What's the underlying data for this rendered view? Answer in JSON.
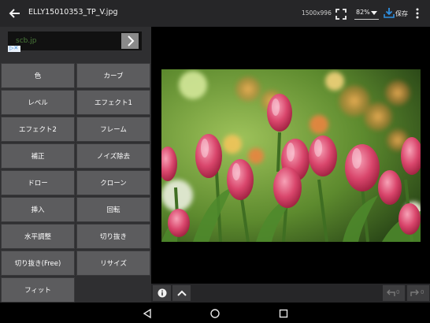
{
  "header": {
    "back_icon": "arrow-left-icon",
    "title": "ELLY15010353_TP_V.jpg",
    "dimensions": "1500x996",
    "fullscreen_icon": "fullscreen-icon",
    "zoom": "82%",
    "save_label": "保存",
    "save_icon": "download-icon",
    "more_icon": "more-vertical-icon"
  },
  "ad": {
    "text": "scb.jp",
    "choices_label": "▷✕"
  },
  "tools": [
    {
      "label": "色"
    },
    {
      "label": "カーブ"
    },
    {
      "label": "レベル"
    },
    {
      "label": "エフェクト1"
    },
    {
      "label": "エフェクト2"
    },
    {
      "label": "フレーム"
    },
    {
      "label": "補正"
    },
    {
      "label": "ノイズ除去"
    },
    {
      "label": "ドロー"
    },
    {
      "label": "クローン"
    },
    {
      "label": "挿入"
    },
    {
      "label": "回転"
    },
    {
      "label": "水平調整"
    },
    {
      "label": "切り抜き"
    },
    {
      "label": "切り抜き(Free)"
    },
    {
      "label": "リサイズ"
    },
    {
      "label": "フィット"
    }
  ],
  "bottom_bar": {
    "info_icon": "info-icon",
    "expand_icon": "chevron-up-icon",
    "undo_count": "0",
    "redo_count": "0"
  },
  "navbar": {
    "back_icon": "nav-back-icon",
    "home_icon": "nav-home-icon",
    "recents_icon": "nav-recents-icon"
  },
  "colors": {
    "topbar": "#262628",
    "panel": "#2f2f31",
    "button": "#5c5c5e",
    "accent": "#2f8fe0"
  }
}
